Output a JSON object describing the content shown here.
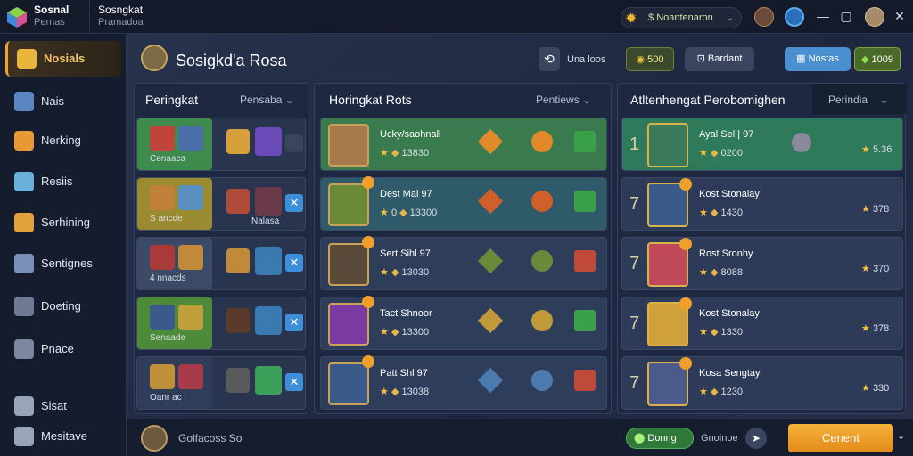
{
  "window": {
    "app_title": "Sosnal",
    "app_subtitle": "Pernas",
    "doc_title": "Sosngkat",
    "doc_subtitle": "Pramadoa",
    "currency_symbol": "$",
    "currency_label": "Noantenaron"
  },
  "sidebar": {
    "items": [
      {
        "label": "Nosials",
        "icon": "cube-icon",
        "color": "#e9b53a",
        "active": true
      },
      {
        "label": "Nais",
        "icon": "grid-icon",
        "color": "#5a86c4"
      },
      {
        "label": "Nerking",
        "icon": "box-icon",
        "color": "#e79a33"
      },
      {
        "label": "Resiis",
        "icon": "chart-icon",
        "color": "#6ab0d8"
      },
      {
        "label": "Serhining",
        "icon": "layers-icon",
        "color": "#e2a13b"
      },
      {
        "label": "Sentignes",
        "icon": "list-icon",
        "color": "#7a8fb6"
      },
      {
        "label": "Doeting",
        "icon": "cube-outline-icon",
        "color": "#6f7a94"
      },
      {
        "label": "Pnace",
        "icon": "gear-icon",
        "color": "#7b879e"
      },
      {
        "label": "Sisat",
        "icon": "pin-icon",
        "color": "#9aa4b8"
      },
      {
        "label": "Mesitave",
        "icon": "shield-icon",
        "color": "#9aa4b8"
      }
    ]
  },
  "header": {
    "title": "Sosigkd'a Rosa",
    "btn_icon_label": "Una loos",
    "coin_value": "500",
    "mid_button": "Bardant",
    "blue_button": "Nostas",
    "green_value": "1009"
  },
  "panels": {
    "left": {
      "title": "Peringkat",
      "dropdown": "Pensaba"
    },
    "middle": {
      "title": "Horingkat Rots",
      "dropdown": "Pentiews"
    },
    "right": {
      "title": "Atltenhengat Perobomighen",
      "dropdown": "Perindia"
    }
  },
  "left_cards": [
    {
      "label": "Cenaaca",
      "bg": "#3f8a4d"
    },
    {
      "label": "S ancde",
      "sublabel": "Nalasa",
      "bg": "#9a8a30"
    },
    {
      "label": "4 nnacds",
      "bg": "#3b4a66"
    },
    {
      "label": "Senaade",
      "bg": "#4d8a3a"
    },
    {
      "label": "Oanr ac",
      "bg": "#2f3d5a"
    }
  ],
  "middle_rows": [
    {
      "name": "Ucky/saohnall",
      "score": "13830",
      "bg": "#3a7a4f"
    },
    {
      "name": "Dest Mal 97",
      "mark": "0",
      "score": "13300",
      "bg": "#2f5a6a"
    },
    {
      "name": "Sert Sihl 97",
      "score": "13030",
      "bg": "#2e3d5a"
    },
    {
      "name": "Tact Shnoor",
      "score": "13300",
      "bg": "#2e3d5a"
    },
    {
      "name": "Patt Shl 97",
      "score": "13038",
      "bg": "#2e3d5a"
    }
  ],
  "right_rows": [
    {
      "rank": "1",
      "name": "Ayal Sel | 97",
      "value": "0200",
      "score": "5.36",
      "bg": "#2f7a5a"
    },
    {
      "rank": "7",
      "name": "Kost Stonalay",
      "value": "1430",
      "score": "378",
      "bg": "#2e3b58"
    },
    {
      "rank": "7",
      "name": "Rost Sronhy",
      "value": "8088",
      "score": "370",
      "bg": "#2e3b58"
    },
    {
      "rank": "7",
      "name": "Kost Stonalay",
      "value": "1330",
      "score": "378",
      "bg": "#2e3b58"
    },
    {
      "rank": "7",
      "name": "Kosa Sengtay",
      "value": "1230",
      "score": "330",
      "bg": "#2e3b58"
    }
  ],
  "bottom": {
    "input_text": "Golfacoss So",
    "green_button": "Donng",
    "mid_text": "Gnoinoe",
    "primary_button": "Cenent"
  }
}
